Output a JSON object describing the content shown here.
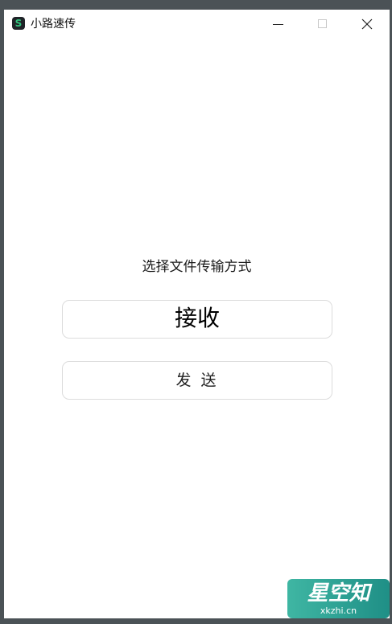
{
  "window": {
    "title": "小路速传",
    "app_icon": "s-logo-icon"
  },
  "controls": {
    "minimize_icon": "minimize-icon",
    "maximize_icon": "maximize-icon",
    "close_icon": "close-icon"
  },
  "main": {
    "prompt": "选择文件传输方式",
    "receive_label": "接收",
    "send_label": "发 送"
  },
  "watermark": {
    "text": "星空知",
    "sub": "xkzhi.cn",
    "colors": [
      "#3fb6a3",
      "#1f8f86"
    ]
  }
}
